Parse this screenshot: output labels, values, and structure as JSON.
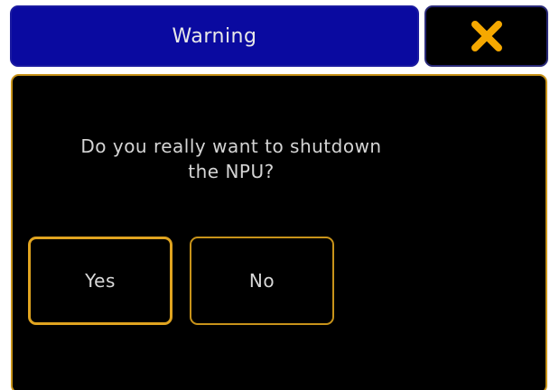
{
  "dialog": {
    "title": "Warning",
    "message_line1": "Do you really want to shutdown",
    "message_line2": "the NPU?",
    "yes_label": "Yes",
    "no_label": "No",
    "close_icon": "close-x-icon"
  },
  "colors": {
    "title_bar": "#0a0aa0",
    "panel_border": "#c8931a",
    "close_icon": "#f5a800",
    "background": "#000000",
    "text": "#d4d4d4"
  }
}
